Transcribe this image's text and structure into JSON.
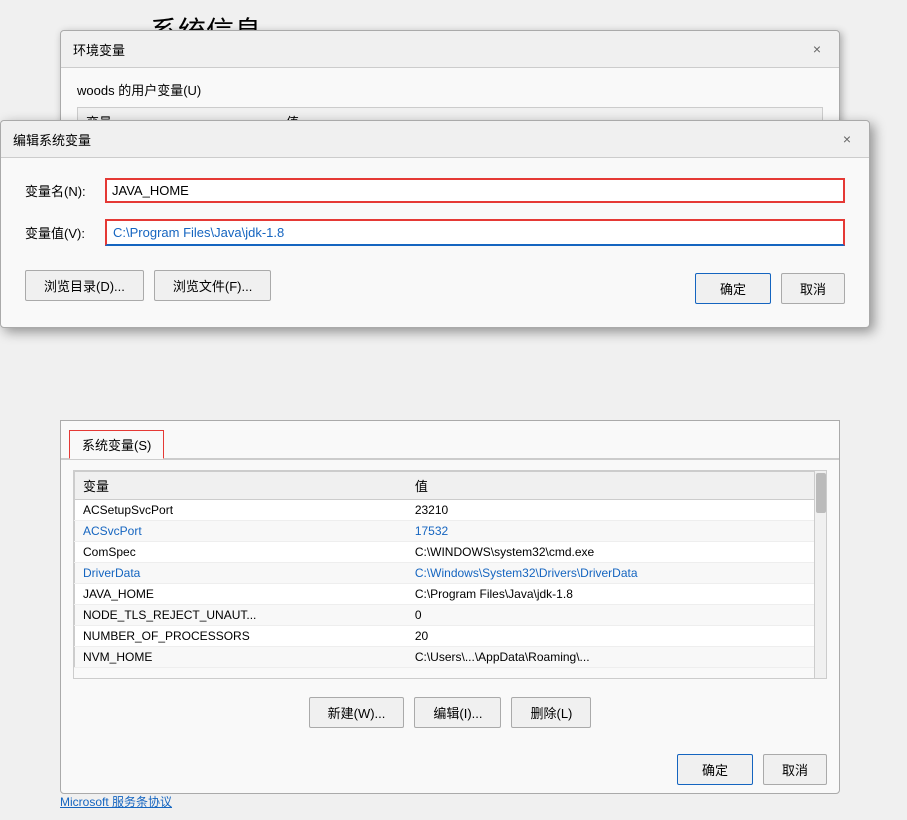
{
  "page": {
    "title": "系统信息"
  },
  "env_dialog": {
    "title": "环境变量",
    "user_section_label": "woods 的用户变量(U)",
    "var_col": "变量",
    "val_col": "值",
    "partial_row": "..."
  },
  "edit_dialog": {
    "title": "编辑系统变量",
    "close_label": "×",
    "var_name_label": "变量名(N):",
    "var_value_label": "变量值(V):",
    "var_name_value": "JAVA_HOME",
    "var_value_value": "C:\\Program Files\\Java\\jdk-1.8",
    "browse_dir_label": "浏览目录(D)...",
    "browse_file_label": "浏览文件(F)...",
    "ok_label": "确定",
    "cancel_label": "取消"
  },
  "sys_vars": {
    "tab_label": "系统变量(S)",
    "var_col": "变量",
    "val_col": "值",
    "rows": [
      {
        "name": "ACSetupSvcPort",
        "value": "23210",
        "highlight": false
      },
      {
        "name": "ACSvcPort",
        "value": "17532",
        "highlight": true
      },
      {
        "name": "ComSpec",
        "value": "C:\\WINDOWS\\system32\\cmd.exe",
        "highlight": false
      },
      {
        "name": "DriverData",
        "value": "C:\\Windows\\System32\\Drivers\\DriverData",
        "highlight": true
      },
      {
        "name": "JAVA_HOME",
        "value": "C:\\Program Files\\Java\\jdk-1.8",
        "highlight": false
      },
      {
        "name": "NODE_TLS_REJECT_UNAUT...",
        "value": "0",
        "highlight": false
      },
      {
        "name": "NUMBER_OF_PROCESSORS",
        "value": "20",
        "highlight": false
      },
      {
        "name": "NVM_HOME",
        "value": "C:\\Users\\...\\AppData\\Roaming\\...",
        "highlight": false
      }
    ],
    "new_label": "新建(W)...",
    "edit_label": "编辑(I)...",
    "delete_label": "删除(L)",
    "ok_label": "确定",
    "cancel_label": "取消"
  },
  "microsoft_link": "Microsoft 服务条协议"
}
